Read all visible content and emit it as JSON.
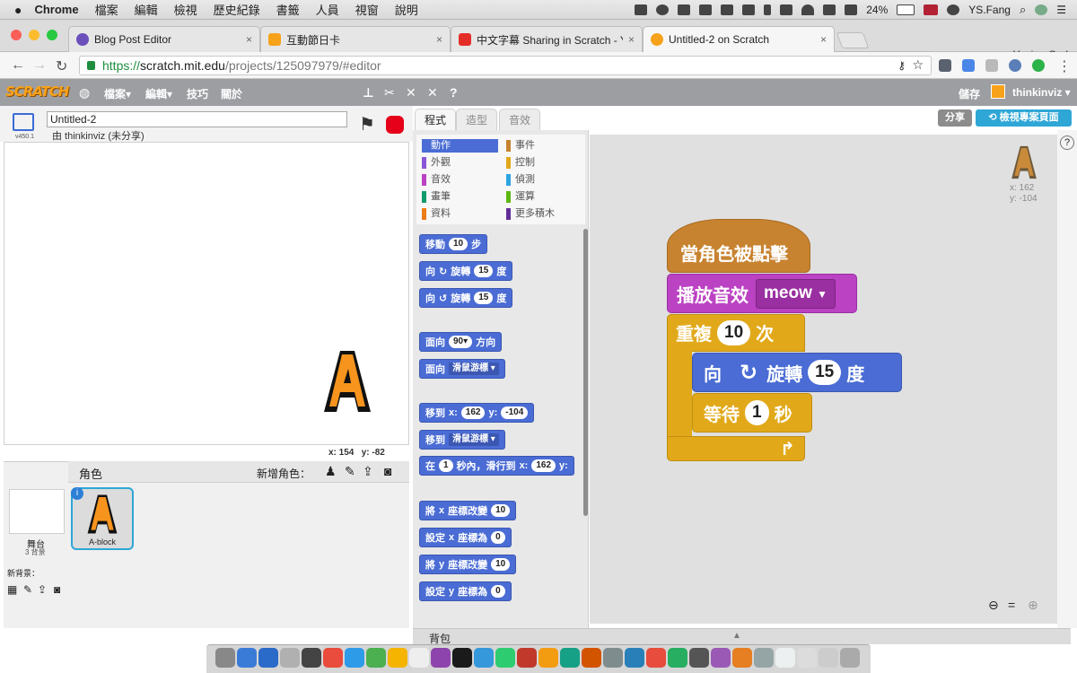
{
  "macbar": {
    "apple": "",
    "app": "Chrome",
    "menus": [
      "檔案",
      "編輯",
      "檢視",
      "歷史紀錄",
      "書籤",
      "人員",
      "視窗",
      "說明"
    ],
    "battery": "24%",
    "user": "YS.Fang"
  },
  "browser": {
    "tabs": [
      {
        "title": "Blog Post Editor",
        "color": "#6b4fbb"
      },
      {
        "title": "互動節日卡",
        "color": "#f7a21b"
      },
      {
        "title": "中文字幕 Sharing in Scratch - Y",
        "color": "#e52d27"
      },
      {
        "title": "Untitled-2 on Scratch",
        "color": "#f7a21b"
      }
    ],
    "close": "×",
    "profile": "Yusian Carl",
    "url_prefix": "https://",
    "url_host": "scratch.mit.edu",
    "url_path": "/projects/125097979/#editor"
  },
  "scratch": {
    "logo": "SCRATCH",
    "menu": [
      "檔案▾",
      "編輯▾",
      "技巧",
      "關於"
    ],
    "save": "儲存",
    "username": "thinkinviz ▾",
    "share_btn": "分享",
    "view_page_btn": "檢視專案頁面",
    "project_title": "Untitled-2",
    "byline": "由 thinkinviz (未分享)",
    "version": "v450.1",
    "mouse_x": "x: 154",
    "mouse_y": "y: -82",
    "sprite_pane": {
      "label": "角色",
      "new_sprite": "新增角色：",
      "stage_label": "舞台",
      "stage_count": "3 背景",
      "new_backdrop": "新背景：",
      "sprite_name": "A-block"
    },
    "palette_tabs": [
      "程式",
      "造型",
      "音效"
    ],
    "categories": [
      {
        "label": "動作",
        "color": "#4a6cd4",
        "selected": true
      },
      {
        "label": "外觀",
        "color": "#8a55d7"
      },
      {
        "label": "音效",
        "color": "#bb42c3"
      },
      {
        "label": "畫筆",
        "color": "#0e9a6c"
      },
      {
        "label": "資料",
        "color": "#ee7d16"
      },
      {
        "label": "事件",
        "color": "#c88330"
      },
      {
        "label": "控制",
        "color": "#e1a91a"
      },
      {
        "label": "偵測",
        "color": "#2ca5e2"
      },
      {
        "label": "運算",
        "color": "#5cb712"
      },
      {
        "label": "更多積木",
        "color": "#632d99"
      }
    ],
    "palette_blocks": {
      "move": [
        "移動",
        "10",
        "步"
      ],
      "turn_right": [
        "向",
        "↻",
        "旋轉",
        "15",
        "度"
      ],
      "turn_left": [
        "向",
        "↺",
        "旋轉",
        "15",
        "度"
      ],
      "point_dir": [
        "面向",
        "90▾",
        "方向"
      ],
      "point_towards": [
        "面向",
        "滑鼠游標 ▾"
      ],
      "goto_xy": [
        "移到",
        "x:",
        "162",
        "y:",
        "-104"
      ],
      "goto": [
        "移到",
        "滑鼠游標 ▾"
      ],
      "glide": [
        "在",
        "1",
        "秒內，滑行到",
        "x:",
        "162",
        "y:"
      ],
      "change_x": [
        "將",
        "x",
        "座標改變",
        "10"
      ],
      "set_x": [
        "設定",
        "x",
        "座標為",
        "0"
      ],
      "change_y": [
        "將",
        "y",
        "座標改變",
        "10"
      ],
      "set_y": [
        "設定",
        "y",
        "座標為",
        "0"
      ]
    },
    "script": {
      "hat": "當角色被點擊",
      "sound_label": "播放音效",
      "sound_value": "meow",
      "repeat_label": "重複",
      "repeat_value": "10",
      "repeat_unit": "次",
      "turn_label": "向",
      "turn_word": "旋轉",
      "turn_value": "15",
      "turn_unit": "度",
      "wait_label": "等待",
      "wait_value": "1",
      "wait_unit": "秒"
    },
    "sprite_info": {
      "x": "x: 162",
      "y": "y: -104"
    },
    "backpack": "背包"
  }
}
